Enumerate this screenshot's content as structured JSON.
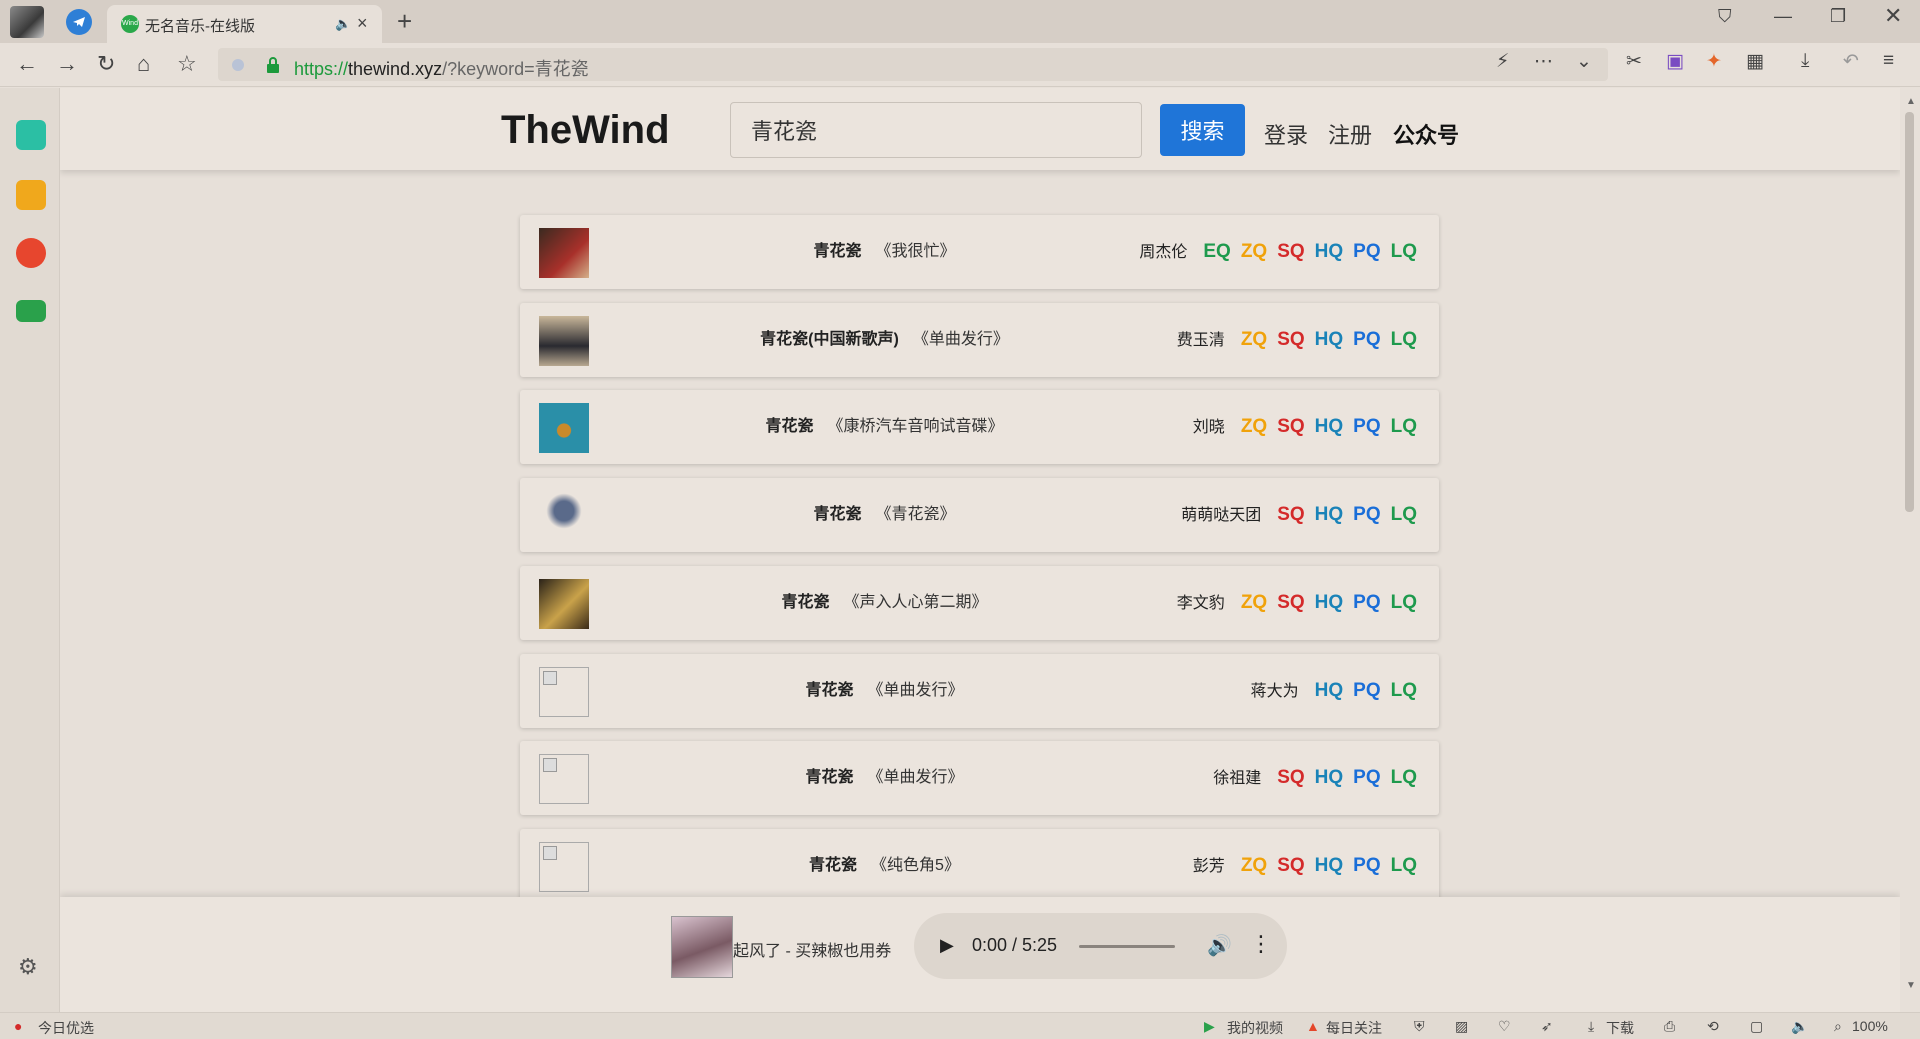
{
  "browser": {
    "tab_title": "无名音乐-在线版",
    "tab_favicon_text": "Wind",
    "url_protocol": "https://",
    "url_host": "thewind.xyz",
    "url_path": "/?keyword=青花瓷"
  },
  "site": {
    "logo": "TheWind",
    "search_value": "青花瓷",
    "search_button": "搜索",
    "login": "登录",
    "register": "注册",
    "official_account": "公众号"
  },
  "results": [
    {
      "title": "青花瓷",
      "album": "《我很忙》",
      "artist": "周杰伦",
      "qualities": [
        "EQ",
        "ZQ",
        "SQ",
        "HQ",
        "PQ",
        "LQ"
      ],
      "cover": "red"
    },
    {
      "title": "青花瓷(中国新歌声)",
      "album": "《单曲发行》",
      "artist": "费玉清",
      "qualities": [
        "ZQ",
        "SQ",
        "HQ",
        "PQ",
        "LQ"
      ],
      "cover": "suit"
    },
    {
      "title": "青花瓷",
      "album": "《康桥汽车音响试音碟》",
      "artist": "刘晓",
      "qualities": [
        "ZQ",
        "SQ",
        "HQ",
        "PQ",
        "LQ"
      ],
      "cover": "disc"
    },
    {
      "title": "青花瓷",
      "album": "《青花瓷》",
      "artist": "萌萌哒天团",
      "qualities": [
        "SQ",
        "HQ",
        "PQ",
        "LQ"
      ],
      "cover": "light"
    },
    {
      "title": "青花瓷",
      "album": "《声入人心第二期》",
      "artist": "李文豹",
      "qualities": [
        "ZQ",
        "SQ",
        "HQ",
        "PQ",
        "LQ"
      ],
      "cover": "gold"
    },
    {
      "title": "青花瓷",
      "album": "《单曲发行》",
      "artist": "蒋大为",
      "qualities": [
        "HQ",
        "PQ",
        "LQ"
      ],
      "cover": "broken"
    },
    {
      "title": "青花瓷",
      "album": "《单曲发行》",
      "artist": "徐祖建",
      "qualities": [
        "SQ",
        "HQ",
        "PQ",
        "LQ"
      ],
      "cover": "broken"
    },
    {
      "title": "青花瓷",
      "album": "《纯色角5》",
      "artist": "彭芳",
      "qualities": [
        "ZQ",
        "SQ",
        "HQ",
        "PQ",
        "LQ"
      ],
      "cover": "broken"
    }
  ],
  "player": {
    "now_playing": "起风了 - 买辣椒也用券",
    "time": "0:00 / 5:25"
  },
  "statusbar": {
    "today_pick": "今日优选",
    "my_video": "我的视频",
    "daily_follow": "每日关注",
    "download": "下载",
    "zoom": "100%"
  },
  "colors": {
    "accent_blue": "#1f75d8",
    "EQ": "#1e9a4d",
    "ZQ": "#f0a20a",
    "SQ": "#d42a2a",
    "HQ": "#1a83b8",
    "PQ": "#1a6ed8",
    "LQ": "#1e9a4d"
  }
}
